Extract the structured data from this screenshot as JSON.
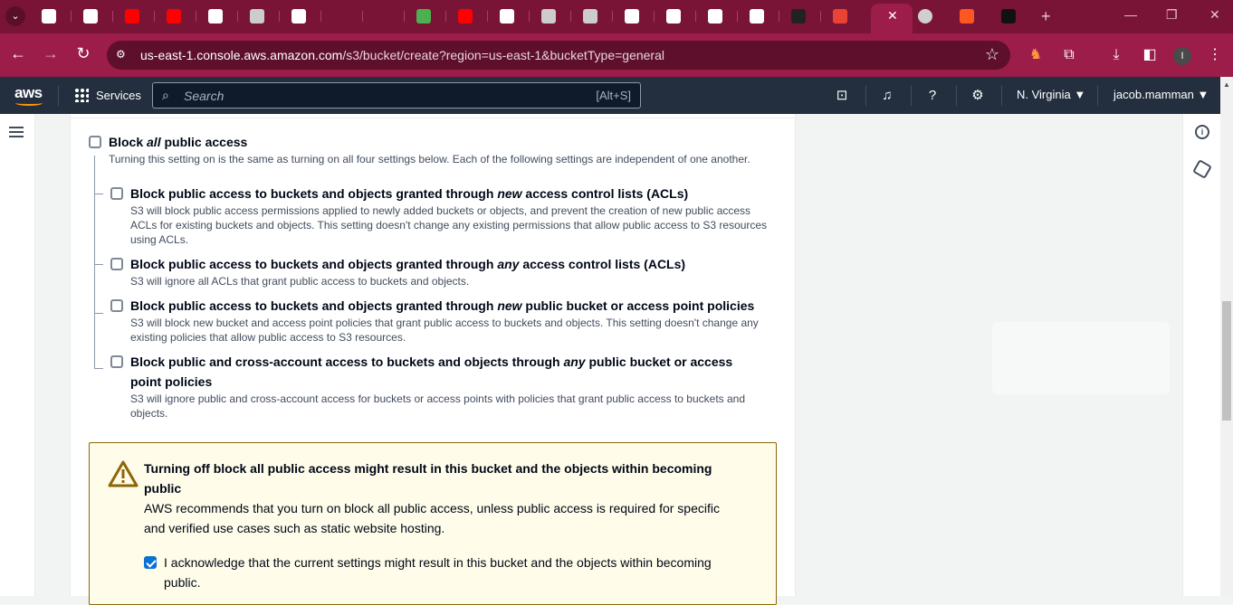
{
  "browser": {
    "active_tab_close": "✕",
    "new_tab": "+",
    "address": {
      "host": "us-east-1.console.aws.amazon.com",
      "path": "/s3/bucket/create?region=us-east-1&bucketType=general"
    },
    "profile_initial": "I",
    "tab_favicons": [
      {
        "icon": "chrome-icon",
        "color": "#ffffff"
      },
      {
        "icon": "octopus-icon",
        "color": "#ffffff"
      },
      {
        "icon": "youtube-icon",
        "color": "#ff0000"
      },
      {
        "icon": "youtube-icon",
        "color": "#ff0000"
      },
      {
        "icon": "github-icon",
        "color": "#ffffff"
      },
      {
        "icon": "openai-icon",
        "color": "#cccccc"
      },
      {
        "icon": "notepad-icon",
        "color": "#ffffff"
      },
      {
        "icon": "dash-icon",
        "color": "#7a1436"
      },
      {
        "icon": "dash-icon",
        "color": "#7a1436"
      },
      {
        "icon": "green-app-icon",
        "color": "#4caf50"
      },
      {
        "icon": "youtube-icon",
        "color": "#ff0000"
      },
      {
        "icon": "medium-icon",
        "color": "#ffffff"
      },
      {
        "icon": "github-copilot-icon",
        "color": "#cccccc"
      },
      {
        "icon": "github-copilot-icon",
        "color": "#cccccc"
      },
      {
        "icon": "pluralsight-icon",
        "color": "#ffffff"
      },
      {
        "icon": "bars-icon",
        "color": "#ffffff"
      },
      {
        "icon": "chatgpt-icon",
        "color": "#ffffff"
      },
      {
        "icon": "google-icon",
        "color": "#ffffff"
      },
      {
        "icon": "github-icon",
        "color": "#222222"
      },
      {
        "icon": "gmail-icon",
        "color": "#ea4335"
      }
    ]
  },
  "aws_header": {
    "logo": "aws",
    "services": "Services",
    "search_placeholder": "Search",
    "search_shortcut": "[Alt+S]",
    "region": "N. Virginia ▼",
    "user": "jacob.mamman ▼"
  },
  "block_public_access": {
    "all": {
      "label_pre": "Block ",
      "label_em": "all",
      "label_post": " public access",
      "description": "Turning this setting on is the same as turning on all four settings below. Each of the following settings are independent of one another.",
      "checked": false
    },
    "options": [
      {
        "label_pre": "Block public access to buckets and objects granted through ",
        "label_em": "new",
        "label_post": " access control lists (ACLs)",
        "description": "S3 will block public access permissions applied to newly added buckets or objects, and prevent the creation of new public access ACLs for existing buckets and objects. This setting doesn't change any existing permissions that allow public access to S3 resources using ACLs.",
        "checked": false
      },
      {
        "label_pre": "Block public access to buckets and objects granted through ",
        "label_em": "any",
        "label_post": " access control lists (ACLs)",
        "description": "S3 will ignore all ACLs that grant public access to buckets and objects.",
        "checked": false
      },
      {
        "label_pre": "Block public access to buckets and objects granted through ",
        "label_em": "new",
        "label_post": " public bucket or access point policies",
        "description": "S3 will block new bucket and access point policies that grant public access to buckets and objects. This setting doesn't change any existing policies that allow public access to S3 resources.",
        "checked": false
      },
      {
        "label_pre": "Block public and cross-account access to buckets and objects through ",
        "label_em": "any",
        "label_post": " public bucket or access point policies",
        "description": "S3 will ignore public and cross-account access for buckets or access points with policies that grant public access to buckets and objects.",
        "checked": false
      }
    ]
  },
  "warning": {
    "title": "Turning off block all public access might result in this bucket and the objects within becoming public",
    "body": "AWS recommends that you turn on block all public access, unless public access is required for specific and verified use cases such as static website hosting.",
    "acknowledge_label": "I acknowledge that the current settings might result in this bucket and the objects within becoming public.",
    "acknowledge_checked": true
  },
  "colors": {
    "browser_frame": "#7a1436",
    "browser_toolbar": "#9c1c4a",
    "aws_nav": "#232f3e",
    "aws_orange": "#ff9900",
    "checkbox_checked": "#0972d3",
    "warning_bg": "#fffce9",
    "warning_border": "#8d6605"
  }
}
